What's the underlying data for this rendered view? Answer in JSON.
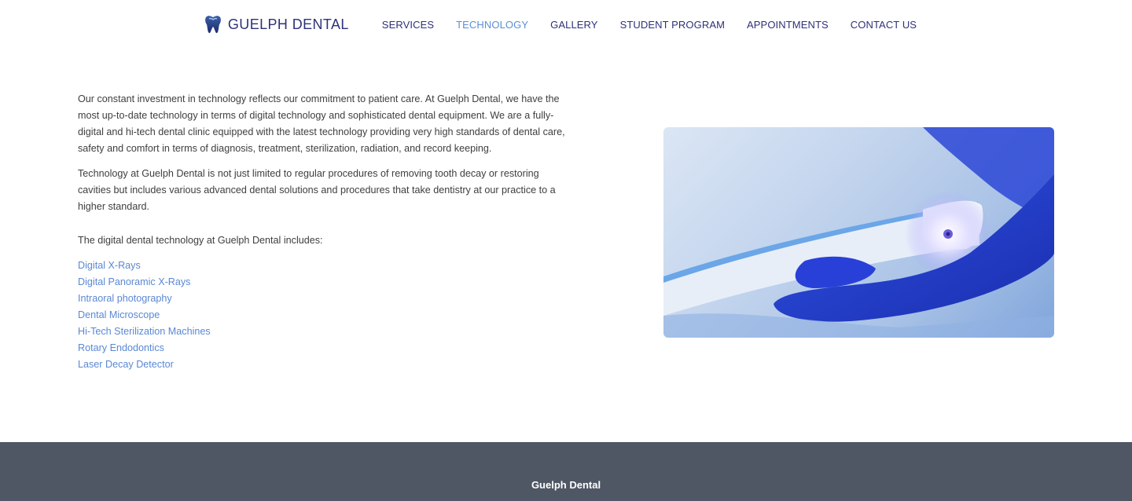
{
  "header": {
    "brand": "GUELPH DENTAL",
    "nav": [
      {
        "label": "SERVICES"
      },
      {
        "label": "TECHNOLOGY",
        "active": true
      },
      {
        "label": "GALLERY"
      },
      {
        "label": "STUDENT PROGRAM"
      },
      {
        "label": "APPOINTMENTS"
      },
      {
        "label": "CONTACT US"
      }
    ]
  },
  "main": {
    "paragraph1": "Our constant investment in technology reflects our commitment to patient care. At Guelph Dental, we have the most up-to-date technology in terms of digital technology and sophisticated dental equipment. We are a fully-digital and hi-tech dental clinic equipped with the latest technology providing very high standards of dental care, safety and comfort in terms of diagnosis, treatment, sterilization, radiation, and record keeping.",
    "paragraph2": "Technology at Guelph Dental is not just limited to regular procedures of removing tooth decay or restoring cavities but includes various advanced dental solutions and procedures that take dentistry at our practice to a higher standard.",
    "list_intro": "The digital dental technology at Guelph Dental includes:",
    "tech_list": [
      "Digital X-Rays",
      "Digital Panoramic X-Rays",
      "Intraoral photography",
      "Dental Microscope",
      "Hi-Tech Sterilization Machines",
      "Rotary Endodontics",
      "Laser Decay Detector"
    ]
  },
  "footer": {
    "title": "Guelph Dental"
  },
  "colors": {
    "brand_navy": "#2e3179",
    "link_blue": "#5a88d4",
    "footer_bg": "#4f5664"
  },
  "icons": {
    "logo": "tooth-icon"
  }
}
